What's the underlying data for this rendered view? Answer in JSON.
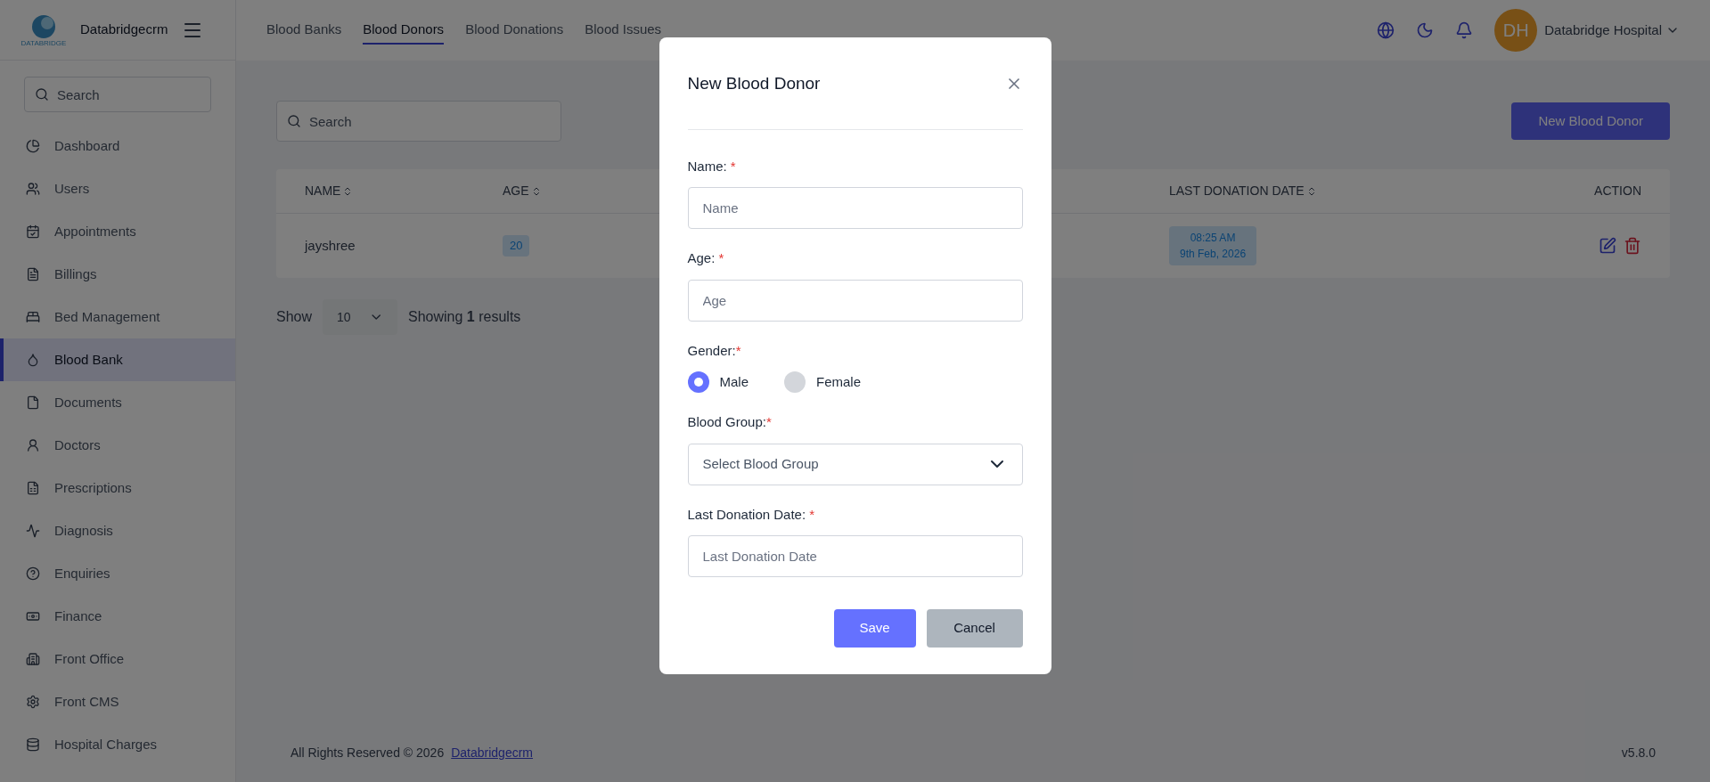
{
  "brand": {
    "name": "Databridgecrm",
    "logo_text": "DATABRIDGE"
  },
  "sidebar": {
    "search_placeholder": "Search",
    "items": [
      {
        "label": "Dashboard",
        "selected": false
      },
      {
        "label": "Users",
        "selected": false
      },
      {
        "label": "Appointments",
        "selected": false
      },
      {
        "label": "Billings",
        "selected": false
      },
      {
        "label": "Bed Management",
        "selected": false
      },
      {
        "label": "Blood Bank",
        "selected": true
      },
      {
        "label": "Documents",
        "selected": false
      },
      {
        "label": "Doctors",
        "selected": false
      },
      {
        "label": "Prescriptions",
        "selected": false
      },
      {
        "label": "Diagnosis",
        "selected": false
      },
      {
        "label": "Enquiries",
        "selected": false
      },
      {
        "label": "Finance",
        "selected": false
      },
      {
        "label": "Front Office",
        "selected": false
      },
      {
        "label": "Front CMS",
        "selected": false
      },
      {
        "label": "Hospital Charges",
        "selected": false
      }
    ]
  },
  "tabs": [
    {
      "label": "Blood Banks",
      "selected": false
    },
    {
      "label": "Blood Donors",
      "selected": true
    },
    {
      "label": "Blood Donations",
      "selected": false
    },
    {
      "label": "Blood Issues",
      "selected": false
    }
  ],
  "user": {
    "initials": "DH",
    "name": "Databridge Hospital"
  },
  "toolbar": {
    "search_placeholder": "Search",
    "new_button": "New Blood Donor"
  },
  "table": {
    "columns": [
      {
        "label": "NAME",
        "sortable": true
      },
      {
        "label": "AGE",
        "sortable": true
      },
      {
        "label": "LAST DONATION DATE",
        "sortable": true
      },
      {
        "label": "ACTION",
        "sortable": false
      }
    ],
    "rows": [
      {
        "name": "jayshree",
        "age": "20",
        "time": "08:25 AM",
        "date": "9th Feb, 2026"
      }
    ]
  },
  "pagination": {
    "show_label": "Show",
    "per_page": "10",
    "summary": "Showing **1** results"
  },
  "footer": {
    "text": "All Rights Reserved © 2026",
    "link": "Databridgecrm",
    "version": "v5.8.0"
  },
  "modal": {
    "title": "New Blood Donor",
    "fields": [
      {
        "kind": "text",
        "label": "Name:",
        "mark": " *",
        "placeholder": "Name"
      },
      {
        "kind": "text",
        "label": "Age:",
        "mark": " *",
        "placeholder": "Age"
      },
      {
        "kind": "radio",
        "label": "Gender:",
        "mark": "*",
        "options": [
          {
            "label": "Male",
            "selected": true
          },
          {
            "label": "Female",
            "selected": false
          }
        ]
      },
      {
        "kind": "select",
        "label": "Blood Group:",
        "mark": "*",
        "placeholder": "Select Blood Group"
      },
      {
        "kind": "text",
        "label": "Last Donation Date:",
        "mark": " *",
        "placeholder": "Last Donation Date"
      }
    ],
    "save": "Save",
    "cancel": "Cancel"
  }
}
